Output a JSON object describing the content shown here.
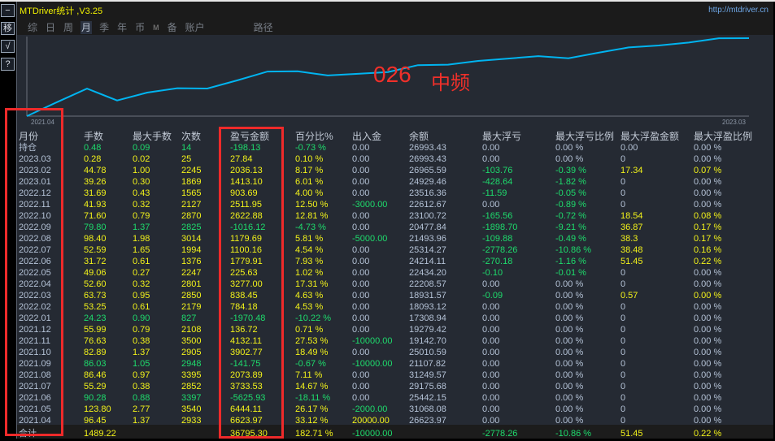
{
  "app": {
    "title": "MTDriver统计 ,V3.25",
    "url": "http://mtdriver.cn"
  },
  "left_buttons": [
    {
      "label": "−",
      "icon": "minimize-icon"
    },
    {
      "label": "移",
      "icon": "move-icon"
    },
    {
      "label": "√",
      "icon": "check-icon"
    },
    {
      "label": "?",
      "icon": "help-icon"
    }
  ],
  "tabs": [
    {
      "label": "综"
    },
    {
      "label": "日"
    },
    {
      "label": "周"
    },
    {
      "label": "月",
      "active": true
    },
    {
      "label": "季"
    },
    {
      "label": "年"
    },
    {
      "label": "币"
    },
    {
      "label": "M"
    },
    {
      "label": "备"
    },
    {
      "label": "账户"
    },
    {
      "label": "路径"
    }
  ],
  "chart_data": {
    "type": "line",
    "x_start_label": "2021.04",
    "x_end_label": "2023.03",
    "series_color": "#00b4f0",
    "source": "cumulative 盈亏金额 by month"
  },
  "annotation": {
    "code": "026",
    "label": "中频",
    "color": "#ee2a2a"
  },
  "colors": {
    "profit": "#f2f21a",
    "loss": "#1edb6c",
    "neutral": "#b4c2d6"
  },
  "table": {
    "headers": [
      "月份",
      "手数",
      "最大手数",
      "次数",
      "盈亏金额",
      "百分比%",
      "出入金",
      "余额",
      "最大浮亏",
      "最大浮亏比例",
      "最大浮盈金额",
      "最大浮盈比例"
    ],
    "rows": [
      [
        "持仓",
        "0.48",
        "0.09",
        "14",
        "-198.13",
        "-0.73 %",
        "0.00",
        "26993.43",
        "0.00",
        "0.00 %",
        "0.00",
        "0.00 %"
      ],
      [
        "2023.03",
        "0.28",
        "0.02",
        "25",
        "27.84",
        "0.10 %",
        "0.00",
        "26993.43",
        "0.00",
        "0.00 %",
        "0",
        "0.00 %"
      ],
      [
        "2023.02",
        "44.78",
        "1.00",
        "2245",
        "2036.13",
        "8.17 %",
        "0.00",
        "26965.59",
        "-103.76",
        "-0.39 %",
        "17.34",
        "0.07 %"
      ],
      [
        "2023.01",
        "39.26",
        "0.30",
        "1869",
        "1413.10",
        "6.01 %",
        "0.00",
        "24929.46",
        "-428.64",
        "-1.82 %",
        "0",
        "0.00 %"
      ],
      [
        "2022.12",
        "31.69",
        "0.43",
        "1565",
        "903.69",
        "4.00 %",
        "0.00",
        "23516.36",
        "-11.59",
        "-0.05 %",
        "0",
        "0.00 %"
      ],
      [
        "2022.11",
        "41.93",
        "0.32",
        "2127",
        "2511.95",
        "12.50 %",
        "-3000.00",
        "22612.67",
        "0.00",
        "-0.89 %",
        "0",
        "0.00 %"
      ],
      [
        "2022.10",
        "71.60",
        "0.79",
        "2870",
        "2622.88",
        "12.81 %",
        "0.00",
        "23100.72",
        "-165.56",
        "-0.72 %",
        "18.54",
        "0.08 %"
      ],
      [
        "2022.09",
        "79.80",
        "1.37",
        "2825",
        "-1016.12",
        "-4.73 %",
        "0.00",
        "20477.84",
        "-1898.70",
        "-9.21 %",
        "36.87",
        "0.17 %"
      ],
      [
        "2022.08",
        "98.40",
        "1.98",
        "3014",
        "1179.69",
        "5.81 %",
        "-5000.00",
        "21493.96",
        "-109.88",
        "-0.49 %",
        "38.3",
        "0.17 %"
      ],
      [
        "2022.07",
        "52.59",
        "1.65",
        "1994",
        "1100.16",
        "4.54 %",
        "0.00",
        "25314.27",
        "-2778.26",
        "-10.86 %",
        "38.48",
        "0.16 %"
      ],
      [
        "2022.06",
        "31.72",
        "0.61",
        "1376",
        "1779.91",
        "7.93 %",
        "0.00",
        "24214.11",
        "-270.18",
        "-1.16 %",
        "51.45",
        "0.22 %"
      ],
      [
        "2022.05",
        "49.06",
        "0.27",
        "2247",
        "225.63",
        "1.02 %",
        "0.00",
        "22434.20",
        "-0.10",
        "-0.01 %",
        "0",
        "0.00 %"
      ],
      [
        "2022.04",
        "52.60",
        "0.32",
        "2801",
        "3277.00",
        "17.31 %",
        "0.00",
        "22208.57",
        "0.00",
        "0.00 %",
        "0",
        "0.00 %"
      ],
      [
        "2022.03",
        "63.73",
        "0.95",
        "2850",
        "838.45",
        "4.63 %",
        "0.00",
        "18931.57",
        "-0.09",
        "0.00 %",
        "0.57",
        "0.00 %"
      ],
      [
        "2022.02",
        "53.25",
        "0.61",
        "2179",
        "784.18",
        "4.53 %",
        "0.00",
        "18093.12",
        "0.00",
        "0.00 %",
        "0",
        "0.00 %"
      ],
      [
        "2022.01",
        "24.23",
        "0.90",
        "827",
        "-1970.48",
        "-10.22 %",
        "0.00",
        "17308.94",
        "0.00",
        "0.00 %",
        "0",
        "0.00 %"
      ],
      [
        "2021.12",
        "55.99",
        "0.79",
        "2108",
        "136.72",
        "0.71 %",
        "0.00",
        "19279.42",
        "0.00",
        "0.00 %",
        "0",
        "0.00 %"
      ],
      [
        "2021.11",
        "76.63",
        "0.38",
        "3500",
        "4132.11",
        "27.53 %",
        "-10000.00",
        "19142.70",
        "0.00",
        "0.00 %",
        "0",
        "0.00 %"
      ],
      [
        "2021.10",
        "82.89",
        "1.37",
        "2905",
        "3902.77",
        "18.49 %",
        "0.00",
        "25010.59",
        "0.00",
        "0.00 %",
        "0",
        "0.00 %"
      ],
      [
        "2021.09",
        "86.03",
        "1.05",
        "2948",
        "-141.75",
        "-0.67 %",
        "-10000.00",
        "21107.82",
        "0.00",
        "0.00 %",
        "0",
        "0.00 %"
      ],
      [
        "2021.08",
        "86.46",
        "0.97",
        "3395",
        "2073.89",
        "7.11 %",
        "0.00",
        "31249.57",
        "0.00",
        "0.00 %",
        "0",
        "0.00 %"
      ],
      [
        "2021.07",
        "55.29",
        "0.38",
        "2852",
        "3733.53",
        "14.67 %",
        "0.00",
        "29175.68",
        "0.00",
        "0.00 %",
        "0",
        "0.00 %"
      ],
      [
        "2021.06",
        "90.28",
        "0.88",
        "3397",
        "-5625.93",
        "-18.11 %",
        "0.00",
        "25442.15",
        "0.00",
        "0.00 %",
        "0",
        "0.00 %"
      ],
      [
        "2021.05",
        "123.80",
        "2.77",
        "3540",
        "6444.11",
        "26.17 %",
        "-2000.00",
        "31068.08",
        "0.00",
        "0.00 %",
        "0",
        "0.00 %"
      ],
      [
        "2021.04",
        "96.45",
        "1.37",
        "2933",
        "6623.97",
        "33.12 %",
        "20000.00",
        "26623.97",
        "0.00",
        "0.00 %",
        "0",
        "0.00 %"
      ]
    ],
    "total": [
      "合计",
      "1489.22",
      "",
      "",
      "36795.30",
      "182.71 %",
      "-10000.00",
      "",
      "-2778.26",
      "-10.86 %",
      "51.45",
      "0.22 %"
    ]
  }
}
